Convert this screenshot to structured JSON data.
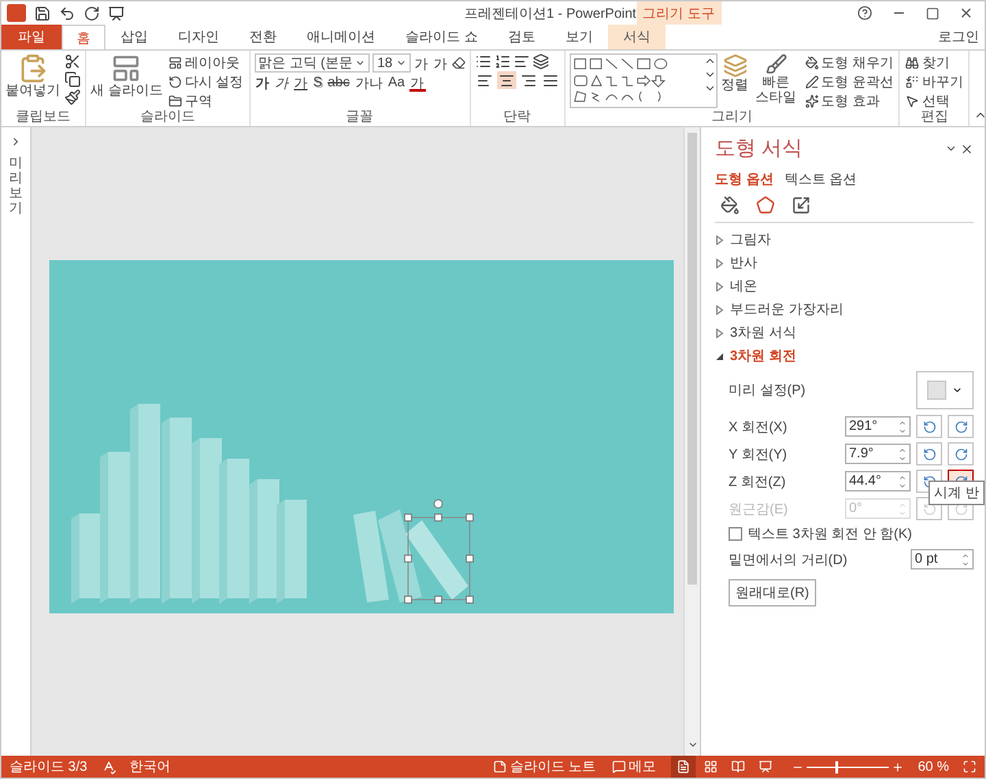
{
  "title_bar": {
    "title": "프레젠테이션1 - PowerPoint",
    "context_label": "그리기 도구"
  },
  "tabs": [
    {
      "label": "파일",
      "kind": "file",
      "selected": false
    },
    {
      "label": "홈",
      "kind": "normal",
      "selected": true
    },
    {
      "label": "삽입",
      "kind": "normal",
      "selected": false
    },
    {
      "label": "디자인",
      "kind": "normal",
      "selected": false
    },
    {
      "label": "전환",
      "kind": "normal",
      "selected": false
    },
    {
      "label": "애니메이션",
      "kind": "normal",
      "selected": false
    },
    {
      "label": "슬라이드 쇼",
      "kind": "normal",
      "selected": false
    },
    {
      "label": "검토",
      "kind": "normal",
      "selected": false
    },
    {
      "label": "보기",
      "kind": "normal",
      "selected": false
    },
    {
      "label": "서식",
      "kind": "context",
      "selected": false
    }
  ],
  "account": "로그인",
  "ribbon": {
    "clipboard": {
      "label": "클립보드",
      "paste": "붙여넣기"
    },
    "slides": {
      "label": "슬라이드",
      "new_slide": "새 슬라이드",
      "commands": [
        "레이아웃",
        "다시 설정",
        "구역"
      ]
    },
    "font": {
      "label": "글꼴",
      "font_name": "맑은 고딕 (본문",
      "font_size": "18",
      "grow": "가",
      "shrink": "가",
      "styles": [
        {
          "kind": "bold",
          "text": "가"
        },
        {
          "kind": "italic",
          "text": "가"
        },
        {
          "kind": "underline",
          "text": "가"
        },
        {
          "kind": "shadow",
          "text": "S"
        },
        {
          "kind": "strike",
          "text": "abc"
        },
        {
          "kind": "spacing",
          "text": "가나"
        },
        {
          "kind": "case",
          "text": "Aa"
        },
        {
          "kind": "color",
          "text": "가"
        }
      ]
    },
    "paragraph": {
      "label": "단락",
      "align": [
        {
          "kind": "left",
          "selected": false
        },
        {
          "kind": "center",
          "selected": true
        },
        {
          "kind": "right",
          "selected": false
        },
        {
          "kind": "justify",
          "selected": false
        }
      ]
    },
    "drawing": {
      "label": "그리기",
      "arrange": "정렬",
      "quick_styles": "빠른 스타일",
      "commands": [
        "도형 채우기",
        "도형 윤곽선",
        "도형 효과"
      ]
    },
    "editing": {
      "label": "편집",
      "commands": [
        "찾기",
        "바꾸기",
        "선택"
      ]
    }
  },
  "thumbnails_label": "미리보기",
  "format_pane": {
    "title": "도형 서식",
    "tabs": [
      {
        "label": "도형 옵션",
        "selected": true
      },
      {
        "label": "텍스트 옵션",
        "selected": false
      }
    ],
    "icon_tabs": [
      {
        "kind": "fill",
        "selected": false
      },
      {
        "kind": "effects",
        "selected": true
      },
      {
        "kind": "size",
        "selected": false
      }
    ],
    "sections": [
      {
        "label": "그림자",
        "expanded": false
      },
      {
        "label": "반사",
        "expanded": false
      },
      {
        "label": "네온",
        "expanded": false
      },
      {
        "label": "부드러운 가장자리",
        "expanded": false
      },
      {
        "label": "3차원 서식",
        "expanded": false
      },
      {
        "label": "3차원 회전",
        "expanded": true
      }
    ],
    "preset_label": "미리 설정(P)",
    "rotations": [
      {
        "label": "X 회전(X)",
        "value": "291°",
        "disabled": false,
        "hovered": false
      },
      {
        "label": "Y 회전(Y)",
        "value": "7.9°",
        "disabled": false,
        "hovered": false
      },
      {
        "label": "Z 회전(Z)",
        "value": "44.4°",
        "disabled": false,
        "hovered": true
      },
      {
        "label": "원근감(E)",
        "value": "0°",
        "disabled": true,
        "hovered": false
      }
    ],
    "tooltip": "시계 반",
    "keep_text_flat": {
      "label": "텍스트 3차원 회전 안 함(K)",
      "checked": false
    },
    "distance": {
      "label": "밑면에서의 거리(D)",
      "value": "0 pt"
    },
    "reset": "원래대로(R)"
  },
  "status_bar": {
    "slide": "슬라이드 3/3",
    "language": "한국어",
    "notes": "슬라이드 노트",
    "comments": "메모",
    "views": [
      {
        "kind": "normal",
        "selected": true
      },
      {
        "kind": "sorter",
        "selected": false
      },
      {
        "kind": "reading",
        "selected": false
      },
      {
        "kind": "show",
        "selected": false
      }
    ],
    "zoom": {
      "level": 0.35,
      "reading": "60 %"
    }
  }
}
